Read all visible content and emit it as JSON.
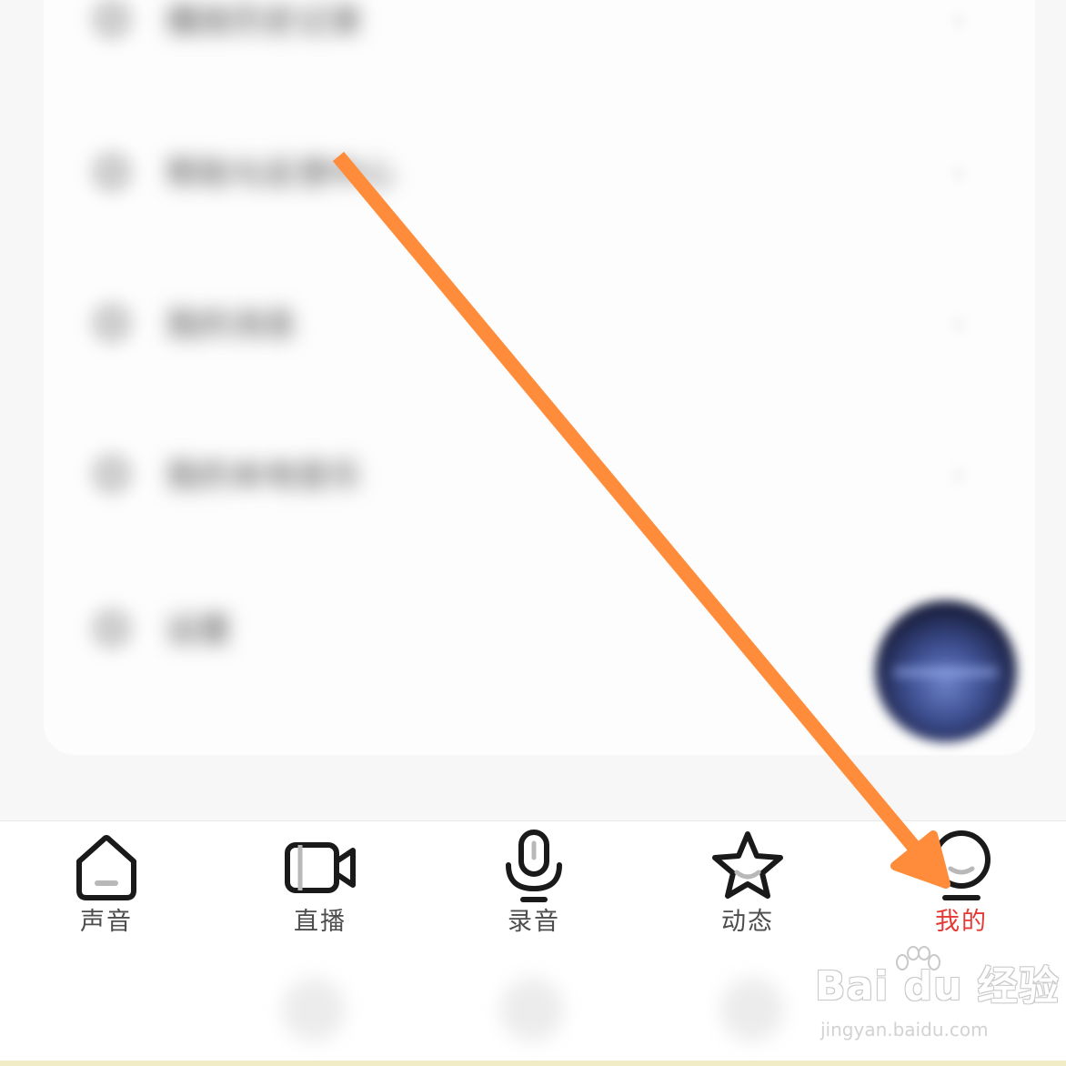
{
  "menu": {
    "rows": [
      {
        "icon": "settings-row-icon",
        "label": "播放历史记录",
        "chevron": "›"
      },
      {
        "icon": "person-row-icon",
        "label": "帮助与反馈中心",
        "chevron": "›"
      },
      {
        "icon": "message-row-icon",
        "label": "我的消息",
        "chevron": "›"
      },
      {
        "icon": "download-row-icon",
        "label": "我的本地音乐",
        "chevron": "›"
      },
      {
        "icon": "gear-row-icon",
        "label": "设置",
        "chevron": ""
      }
    ]
  },
  "player": {
    "icon": "now-playing-cover"
  },
  "tabbar": {
    "active_color": "#e53935",
    "inactive_color": "#4d4d4d",
    "tabs": [
      {
        "label": "声音",
        "icon": "home-icon",
        "active": false
      },
      {
        "label": "直播",
        "icon": "video-camera-icon",
        "active": false
      },
      {
        "label": "录音",
        "icon": "microphone-icon",
        "active": false
      },
      {
        "label": "动态",
        "icon": "star-icon",
        "active": false
      },
      {
        "label": "我的",
        "icon": "profile-smile-icon",
        "active": true
      }
    ]
  },
  "annotation": {
    "color": "#ff8c3a",
    "icon": "pointer-arrow"
  },
  "watermark": {
    "logo": "Bai  du 经验",
    "url": "jingyan.baidu.com"
  }
}
